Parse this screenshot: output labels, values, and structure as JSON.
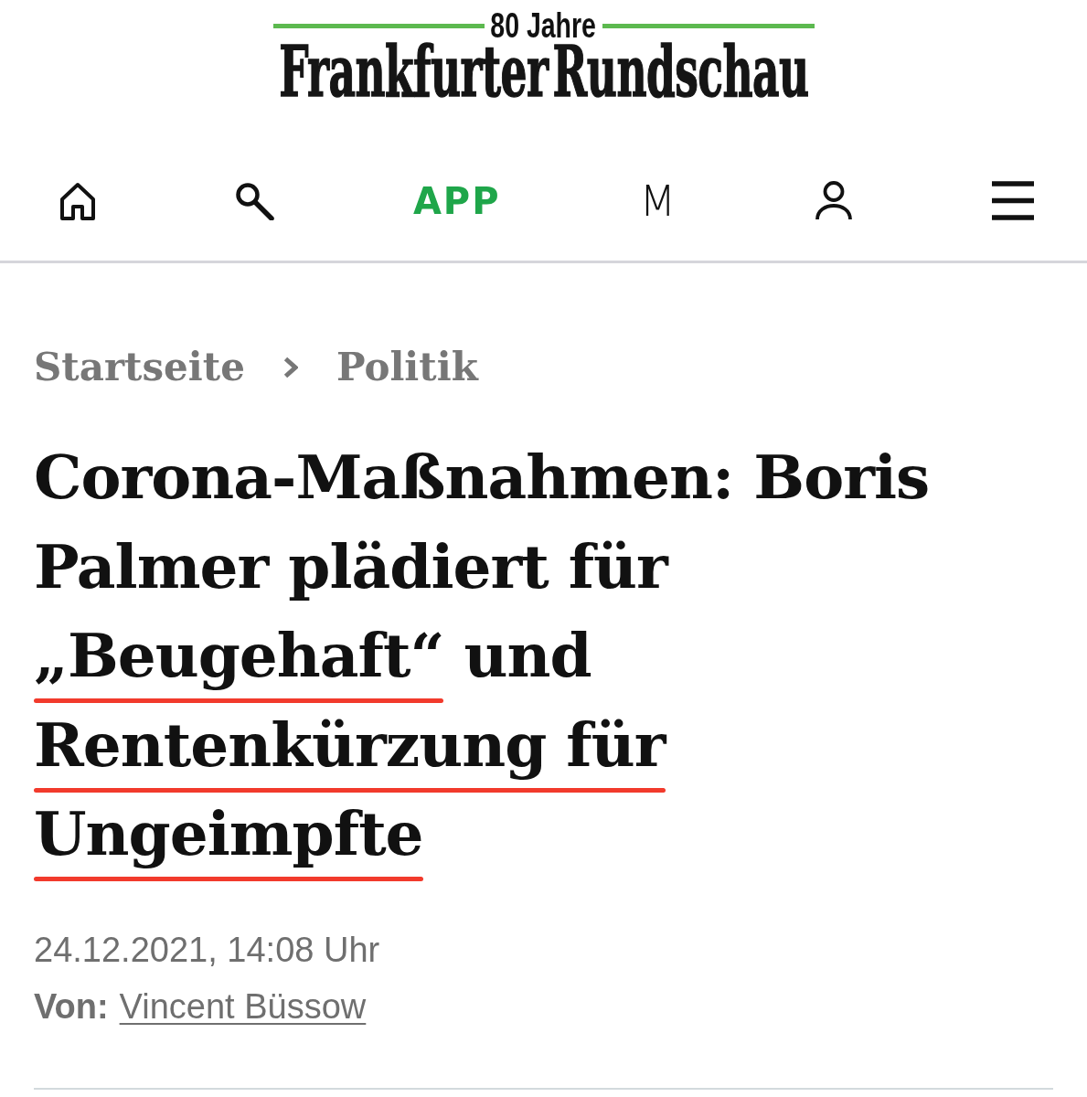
{
  "logo": {
    "tagline": "80 Jahre",
    "wordmark": "Frankfurter Rundschau"
  },
  "nav": {
    "items": [
      {
        "kind": "home"
      },
      {
        "kind": "search"
      },
      {
        "kind": "app",
        "label": "APP"
      },
      {
        "kind": "letter",
        "label": "M"
      },
      {
        "kind": "account"
      },
      {
        "kind": "menu"
      }
    ]
  },
  "breadcrumb": {
    "items": [
      {
        "label": "Startseite"
      },
      {
        "label": "Politik"
      }
    ]
  },
  "headline": {
    "segments": [
      {
        "text": "Corona-Maßnahmen: Boris Palmer plädiert für ",
        "underlined": false
      },
      {
        "text": "„Beugehaft“",
        "underlined": true
      },
      {
        "text": " und ",
        "underlined": false
      },
      {
        "text": "Rentenkürzung für ",
        "underlined": true
      },
      {
        "text": "Ungeimpfte",
        "underlined": true
      }
    ]
  },
  "meta": {
    "date": "24.12.2021, 14:08 Uhr",
    "author_label": "Von:",
    "author": "Vincent Büssow"
  }
}
